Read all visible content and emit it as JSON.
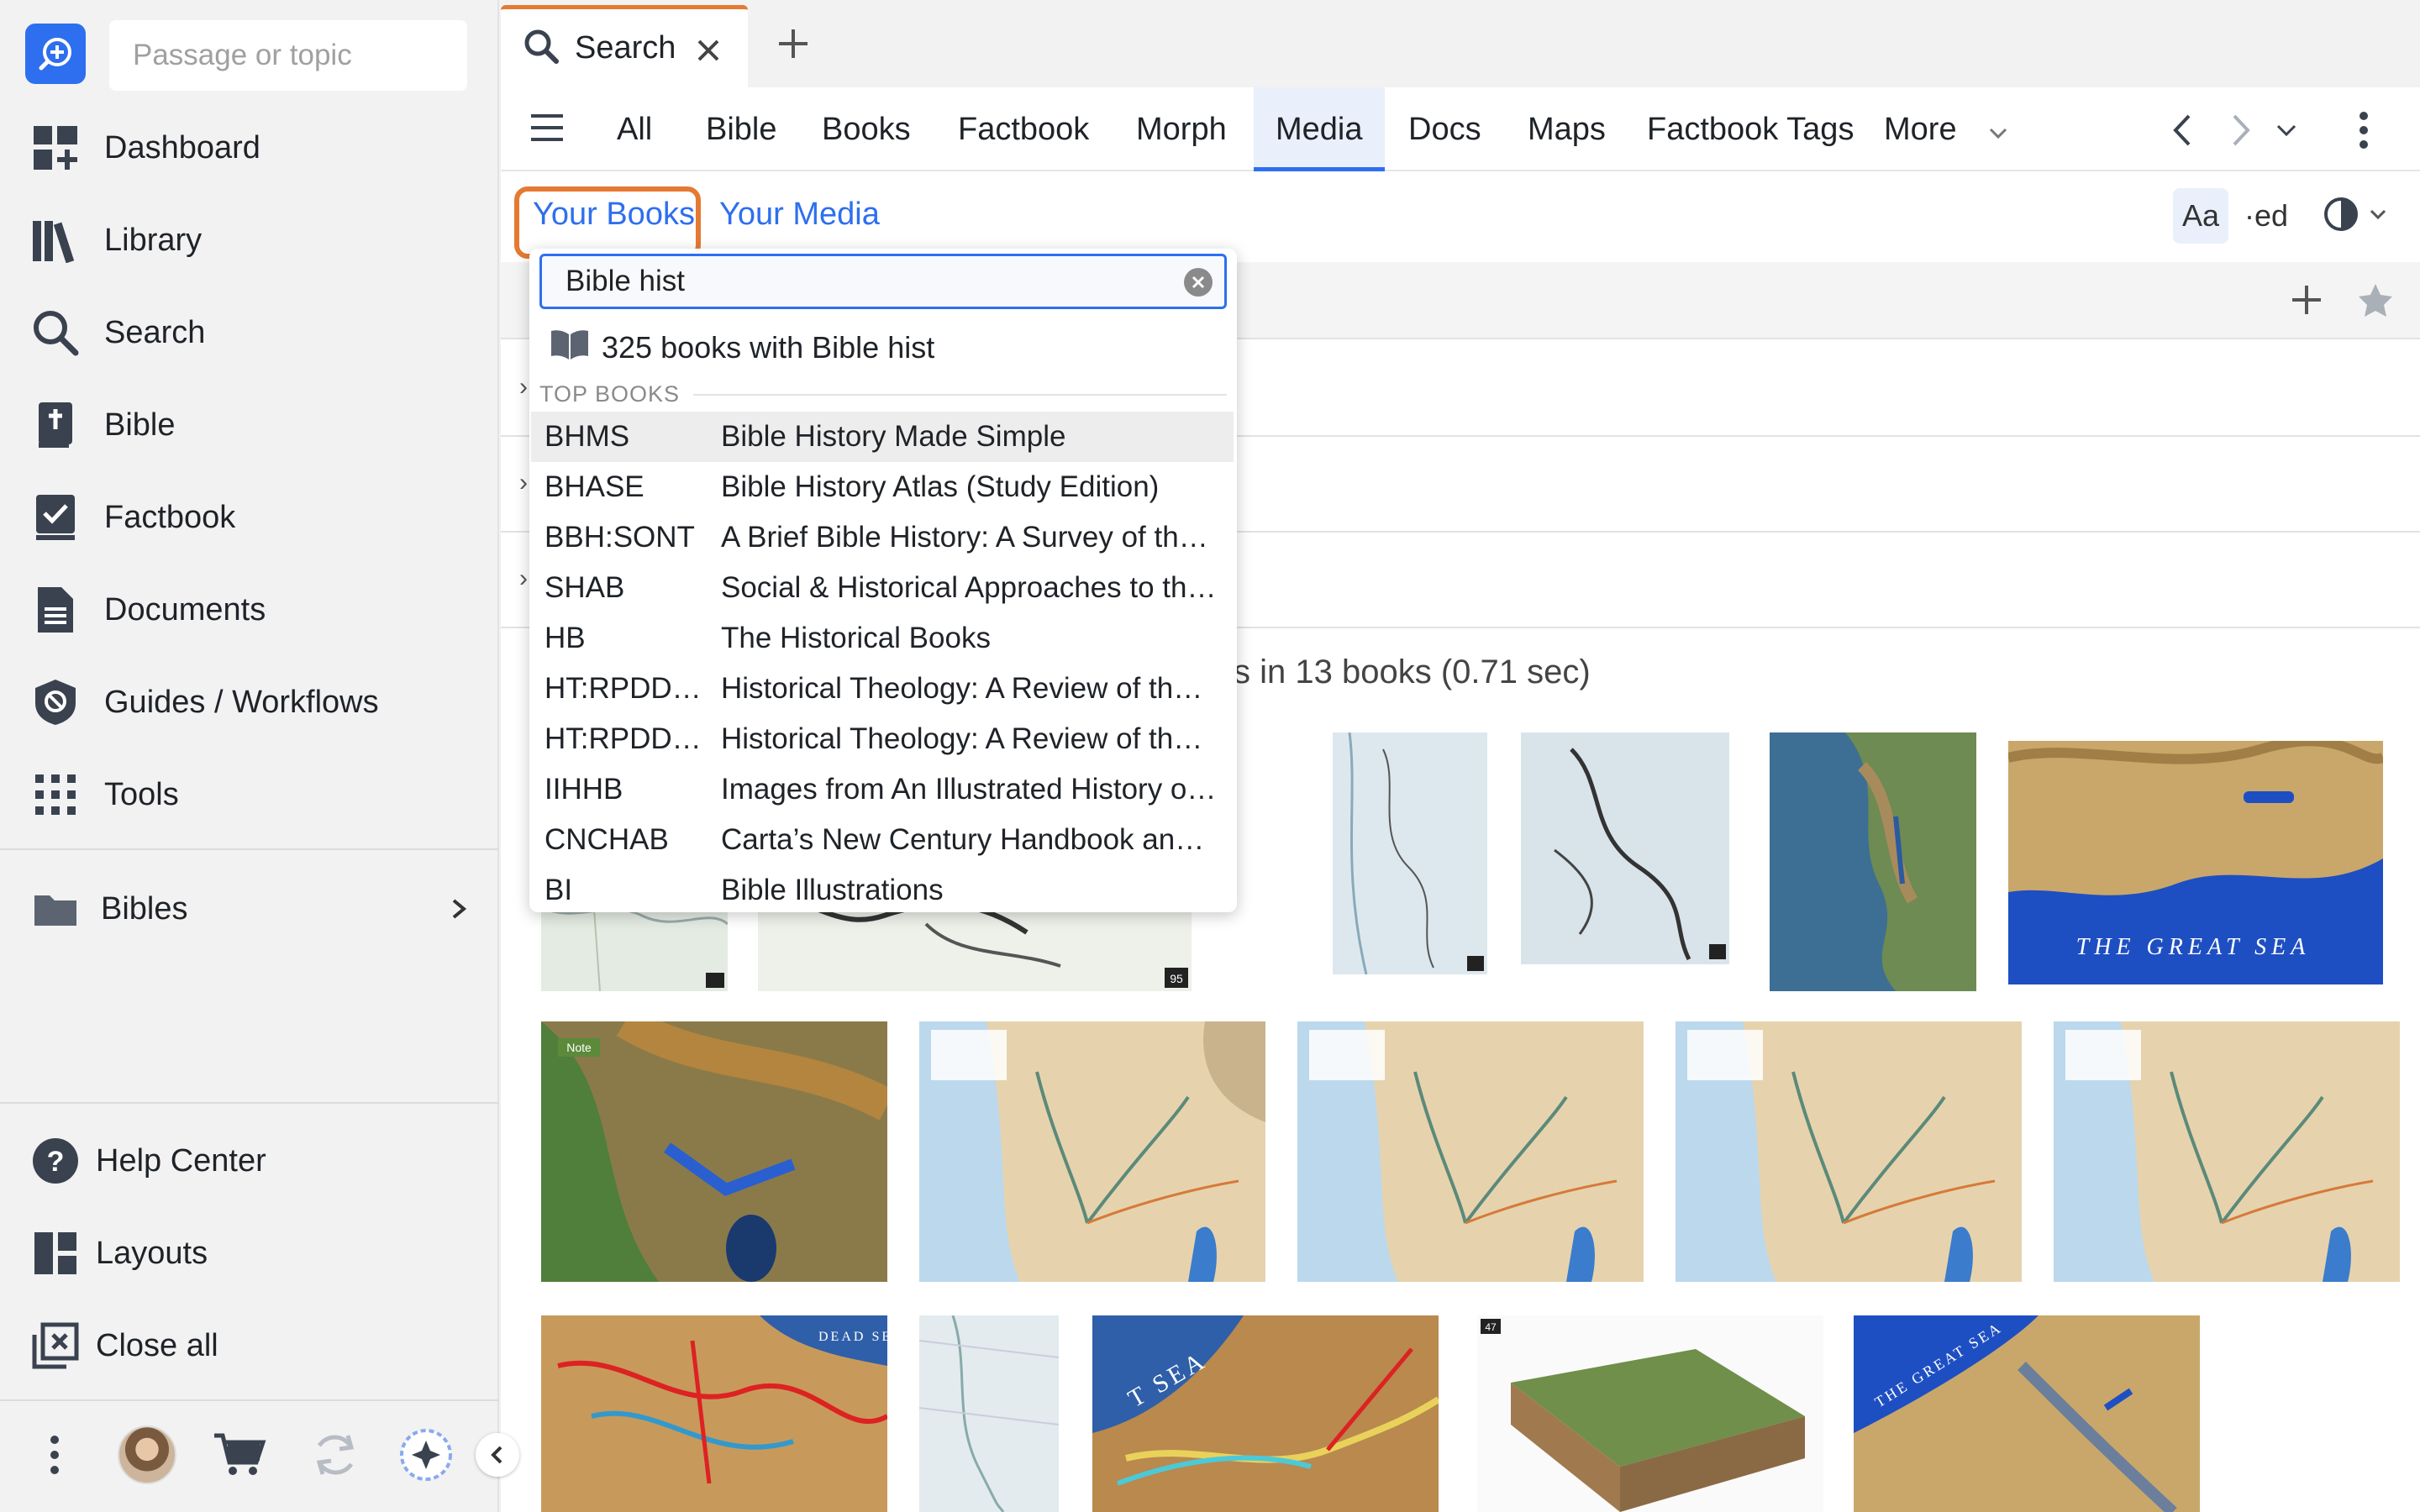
{
  "sidebar": {
    "passage_placeholder": "Passage or topic",
    "nav": [
      {
        "label": "Dashboard"
      },
      {
        "label": "Library"
      },
      {
        "label": "Search"
      },
      {
        "label": "Bible"
      },
      {
        "label": "Factbook"
      },
      {
        "label": "Documents"
      },
      {
        "label": "Guides / Workflows"
      },
      {
        "label": "Tools"
      }
    ],
    "collections": {
      "label": "Bibles"
    },
    "bottom": [
      {
        "label": "Help Center"
      },
      {
        "label": "Layouts"
      },
      {
        "label": "Close all"
      }
    ]
  },
  "tabs": {
    "active_label": "Search"
  },
  "search_types": [
    "All",
    "Bible",
    "Books",
    "Factbook",
    "Morph",
    "Media",
    "Docs",
    "Maps",
    "Factbook Tags",
    "More"
  ],
  "active_search_type": "Media",
  "scope": {
    "your_books": "Your Books",
    "your_media": "Your Media"
  },
  "toolbar": {
    "font_button": "Aa",
    "ed_button": "·ed"
  },
  "results": {
    "summary_visible": "s in 13 books (0.71 sec)"
  },
  "dropdown": {
    "query": "Bible hist",
    "count_label": "325 books with Bible hist",
    "section_label": "TOP BOOKS",
    "books": [
      {
        "abbr": "BHMS",
        "title": "Bible History Made Simple"
      },
      {
        "abbr": "BHASE",
        "title": "Bible History Atlas (Study Edition)"
      },
      {
        "abbr": "BBH:SONT",
        "title": "A Brief Bible History: A Survey of the…"
      },
      {
        "abbr": "SHAB",
        "title": "Social & Historical Approaches to the…"
      },
      {
        "abbr": "HB",
        "title": "The Historical Books"
      },
      {
        "abbr": "HT:RPDD…",
        "title": "Historical Theology: A Review of the…"
      },
      {
        "abbr": "HT:RPDD…",
        "title": "Historical Theology: A Review of the…"
      },
      {
        "abbr": "IIHHB",
        "title": "Images from An Illustrated History of…"
      },
      {
        "abbr": "CNCHAB",
        "title": "Carta’s New Century Handbook and…"
      },
      {
        "abbr": "BI",
        "title": "Bible Illustrations"
      }
    ]
  },
  "map_labels": {
    "great_sea": "THE GREAT SEA",
    "note_tag": "Note",
    "dead_sea": "DEAD SEA",
    "sea_fragment": "T SEA",
    "page_47": "47",
    "page_95": "95"
  },
  "colors": {
    "accent": "#2e6ff0",
    "highlight_orange": "#e57a32"
  }
}
